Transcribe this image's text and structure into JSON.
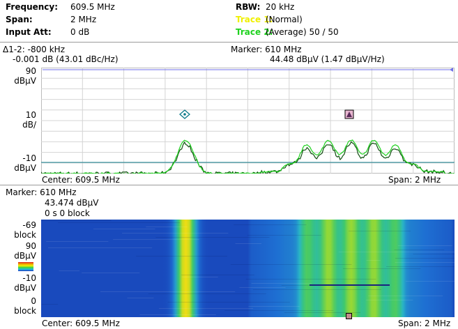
{
  "header": {
    "frequency": {
      "label": "Frequency:",
      "value": "609.5 MHz"
    },
    "span": {
      "label": "Span:",
      "value": "2 MHz"
    },
    "input_att": {
      "label": "Input Att:",
      "value": "0 dB"
    },
    "rbw": {
      "label": "RBW:",
      "value": "20 kHz"
    },
    "trace1": {
      "label": "Trace 1:",
      "value": "(Normal)",
      "color": "#f0f000"
    },
    "trace2": {
      "label": "Trace 2:",
      "value": "(Average)  50 / 50",
      "color": "#1fd21f"
    }
  },
  "delta": {
    "line1": "Δ1-2: -800 kHz",
    "line2": "-0.001 dB (43.01 dBc/Hz)"
  },
  "marker_readout": {
    "line1": "Marker: 610 MHz",
    "line2": "44.48 dBµV (1.47 dBµV/Hz)"
  },
  "spectrum": {
    "y_top_value": "90",
    "y_top_unit": "dBµV",
    "y_scale_value": "10",
    "y_scale_unit": "dB/",
    "y_bottom_value": "-10",
    "y_bottom_unit": "dBµV",
    "center": "Center: 609.5 MHz",
    "span": "Span: 2 MHz"
  },
  "spectrogram": {
    "marker_line1": "Marker: 610 MHz",
    "marker_line2": "43.474 dBµV",
    "marker_line3": "0 s   0 block",
    "y_top_value": "-69",
    "y_top_unit": "block",
    "color_top_value": "90",
    "color_top_unit": "dBµV",
    "color_bottom_value": "-10",
    "color_bottom_unit": "dBµV",
    "y_bottom_value": "0",
    "y_bottom_unit": "block",
    "center": "Center: 609.5 MHz",
    "span": "Span: 2 MHz"
  },
  "chart_data": {
    "type": "line",
    "x_range_mhz": [
      608.5,
      610.5
    ],
    "y_range_dbuv": [
      -10,
      90
    ],
    "grid": true,
    "series": [
      {
        "name": "Trace 1",
        "color": "#f0f000"
      },
      {
        "name": "Trace 2",
        "color": "#1fd21f",
        "points_mhz_dbuv": [
          [
            608.5,
            -10
          ],
          [
            608.9,
            -10.5
          ],
          [
            609.0,
            -9
          ],
          [
            609.1,
            5
          ],
          [
            609.2,
            19
          ],
          [
            609.25,
            22
          ],
          [
            609.3,
            18
          ],
          [
            609.4,
            -8
          ],
          [
            609.6,
            -10
          ],
          [
            609.75,
            -6
          ],
          [
            609.85,
            6
          ],
          [
            609.95,
            18
          ],
          [
            610.0,
            22
          ],
          [
            610.1,
            19
          ],
          [
            610.2,
            6
          ],
          [
            610.35,
            -7
          ],
          [
            610.5,
            -10
          ]
        ]
      }
    ],
    "markers": [
      {
        "label": "1",
        "x_mhz": 609.2,
        "y_dbuv": 22
      },
      {
        "label": "2",
        "x_mhz": 610.0,
        "y_dbuv": 22
      }
    ]
  }
}
